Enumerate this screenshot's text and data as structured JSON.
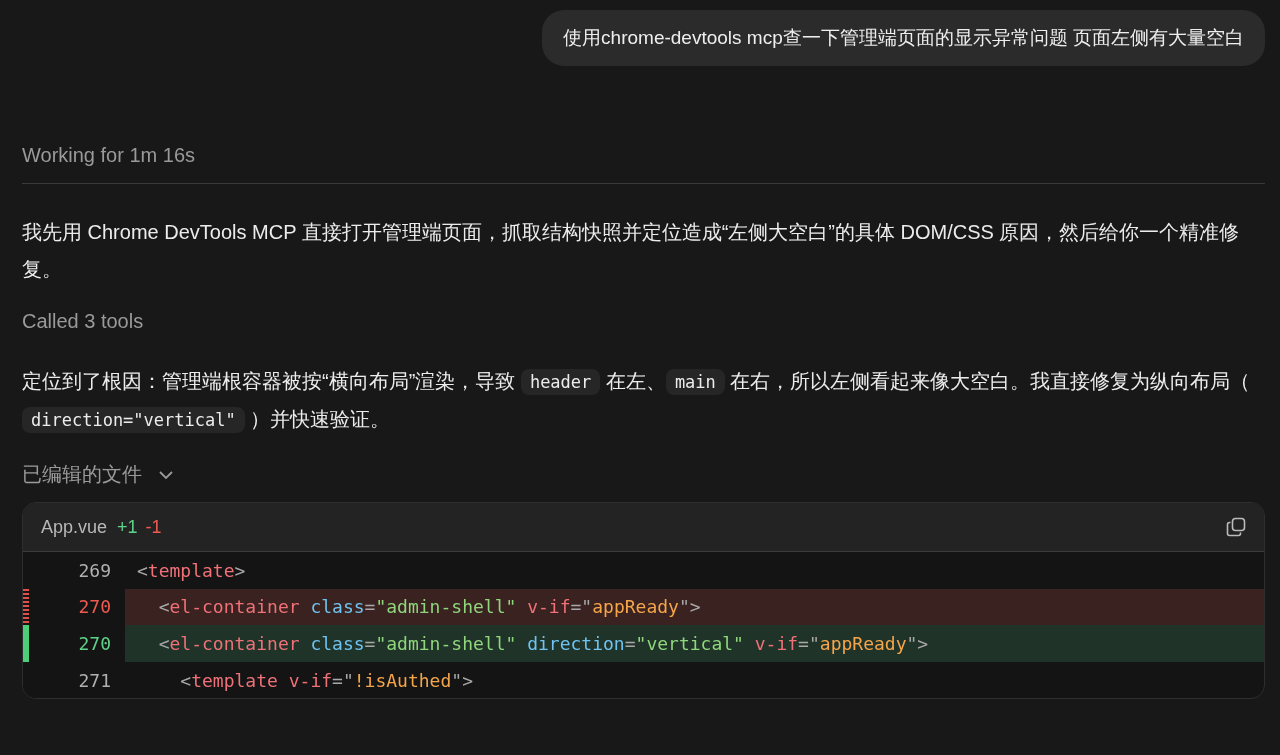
{
  "user_message": "使用chrome-devtools mcp查一下管理端页面的显示异常问题 页面左侧有大量空白",
  "working_status": "Working for 1m 16s",
  "messages": [
    {
      "kind": "paragraph",
      "segments": [
        {
          "kind": "text",
          "text": "我先用 Chrome DevTools MCP 直接打开管理端页面，抓取结构快照并定位造成“左侧大空白”的具体 DOM/CSS 原因，然后给你一个精准修复。"
        }
      ]
    },
    {
      "kind": "note",
      "text": "Called 3 tools"
    },
    {
      "kind": "paragraph",
      "segments": [
        {
          "kind": "text",
          "text": "定位到了根因：管理端根容器被按“横向布局”渲染，导致 "
        },
        {
          "kind": "code",
          "text": "header"
        },
        {
          "kind": "text",
          "text": " 在左、"
        },
        {
          "kind": "code",
          "text": "main"
        },
        {
          "kind": "text",
          "text": " 在右，所以左侧看起来像大空白。我直接修复为纵向布局（ "
        },
        {
          "kind": "code",
          "text": "direction=\"vertical\""
        },
        {
          "kind": "text",
          "text": " ）并快速验证。"
        }
      ]
    }
  ],
  "edited_files": {
    "label": "已编辑的文件",
    "file": {
      "name": "App.vue",
      "added": "+1",
      "removed": "-1",
      "lines": [
        {
          "kind": "context",
          "number": "269",
          "tokens": [
            {
              "kind": "punct",
              "text": "<"
            },
            {
              "kind": "tag",
              "text": "template"
            },
            {
              "kind": "punct",
              "text": ">"
            }
          ]
        },
        {
          "kind": "removed",
          "number": "270",
          "tokens": [
            {
              "kind": "punct",
              "text": "  <"
            },
            {
              "kind": "tag",
              "text": "el-container"
            },
            {
              "kind": "attr",
              "text": " class"
            },
            {
              "kind": "punct",
              "text": "="
            },
            {
              "kind": "string",
              "text": "\"admin-shell\""
            },
            {
              "kind": "tag",
              "text": " v-if"
            },
            {
              "kind": "punct",
              "text": "=\""
            },
            {
              "kind": "value",
              "text": "appReady"
            },
            {
              "kind": "punct",
              "text": "\">"
            }
          ]
        },
        {
          "kind": "added",
          "number": "270",
          "tokens": [
            {
              "kind": "punct",
              "text": "  <"
            },
            {
              "kind": "tag",
              "text": "el-container"
            },
            {
              "kind": "attr",
              "text": " class"
            },
            {
              "kind": "punct",
              "text": "="
            },
            {
              "kind": "string",
              "text": "\"admin-shell\""
            },
            {
              "kind": "attr",
              "text": " direction"
            },
            {
              "kind": "punct",
              "text": "="
            },
            {
              "kind": "string",
              "text": "\"vertical\""
            },
            {
              "kind": "tag",
              "text": " v-if"
            },
            {
              "kind": "punct",
              "text": "=\""
            },
            {
              "kind": "value",
              "text": "appReady"
            },
            {
              "kind": "punct",
              "text": "\">"
            }
          ]
        },
        {
          "kind": "context",
          "number": "271",
          "tokens": [
            {
              "kind": "punct",
              "text": "    <"
            },
            {
              "kind": "tag",
              "text": "template"
            },
            {
              "kind": "tag",
              "text": " v-if"
            },
            {
              "kind": "punct",
              "text": "=\""
            },
            {
              "kind": "value",
              "text": "!isAuthed"
            },
            {
              "kind": "punct",
              "text": "\">"
            }
          ]
        }
      ]
    }
  }
}
